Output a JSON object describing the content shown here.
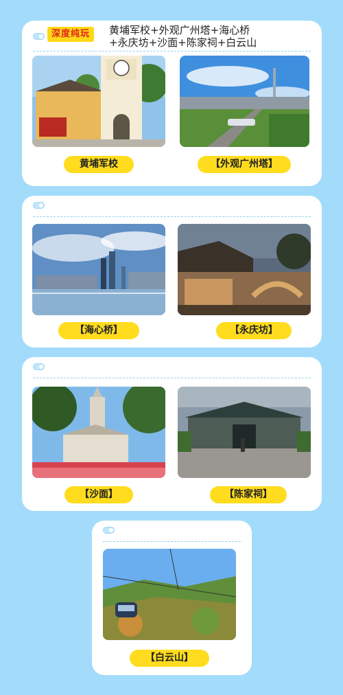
{
  "header": {
    "badge": "深度纯玩",
    "title_line1": "黄埔军校+外观广州塔+海心桥",
    "title_line2": "+永庆坊+沙面+陈家祠+白云山"
  },
  "attractions": [
    {
      "label": "黄埔军校"
    },
    {
      "label": "【外观广州塔】"
    },
    {
      "label": "【海心桥】"
    },
    {
      "label": "【永庆坊】"
    },
    {
      "label": "【沙面】"
    },
    {
      "label": "【陈家祠】"
    },
    {
      "label": "【白云山】"
    }
  ],
  "colors": {
    "background": "#a3dbfb",
    "card": "#ffffff",
    "label_fill": "#ffdc1e",
    "badge_fill": "#ffd817",
    "badge_text": "#e0251a"
  }
}
